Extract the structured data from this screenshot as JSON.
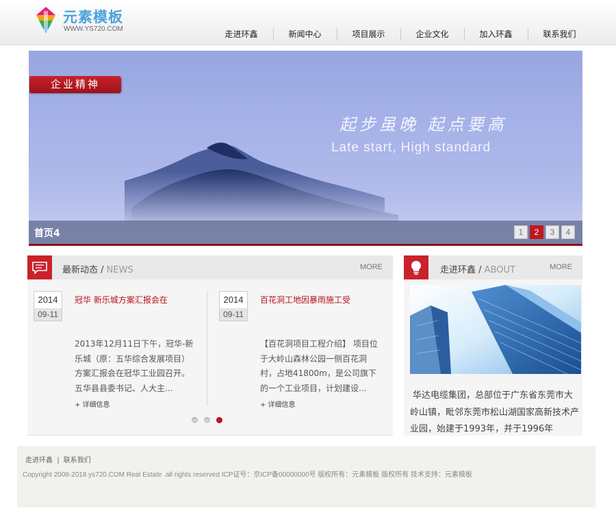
{
  "header": {
    "logo_title": "元素模板",
    "logo_url": "WWW.YS720.COM",
    "nav": [
      {
        "label": "走进环鑫"
      },
      {
        "label": "新闻中心"
      },
      {
        "label": "项目展示"
      },
      {
        "label": "企业文化"
      },
      {
        "label": "加入环鑫"
      },
      {
        "label": "联系我们"
      }
    ]
  },
  "banner": {
    "tag": "企业精神",
    "slogan_cn": "起步虽晚 起点要高",
    "slogan_en": "Late start, High standard",
    "caption": "首页4",
    "pages": [
      "1",
      "2",
      "3",
      "4"
    ],
    "active_page": "2",
    "colors": {
      "accent": "#c0181f",
      "sky": "#a7b3e8",
      "mountain": "#2c3f7a"
    }
  },
  "news": {
    "title": "最新动态",
    "title_en": "NEWS",
    "more": "MORE",
    "items": [
      {
        "year": "2014",
        "date": "09-11",
        "title": "冠华 新乐城方案汇报会在",
        "summary": "2013年12月11日下午，冠华-新乐城（原：五华综合发展项目）方案汇报会在冠华工业园召开。五华县县委书记、人大主...",
        "detail": "+ 详细信息"
      },
      {
        "year": "2014",
        "date": "09-11",
        "title": "百花洞工地因暴雨施工受",
        "summary": "【百花洞项目工程介绍】 项目位于大岭山森林公园一侧百花洞村，占地41800m，是公司旗下的一个工业项目，计划建设...",
        "detail": "+ 详细信息"
      }
    ],
    "carousel_dots": 3,
    "active_dot": 3
  },
  "about": {
    "title": "走进环鑫",
    "title_en": "ABOUT",
    "more": "MORE",
    "text": "华达电缆集团，总部位于广东省东莞市大岭山镇，毗邻东莞市松山湖国家高新技术产业园，始建于1993年，并于1996年"
  },
  "footer": {
    "link_about": "走进环鑫",
    "separator": "|",
    "link_contact": "联系我们",
    "copyright": "Copyright 2008-2018 ys720.COM Real Estate .all rights reserved ICP证号：京ICP备00000000号 版权所有：元素模板 版权所有   技术支持：元素模板"
  }
}
